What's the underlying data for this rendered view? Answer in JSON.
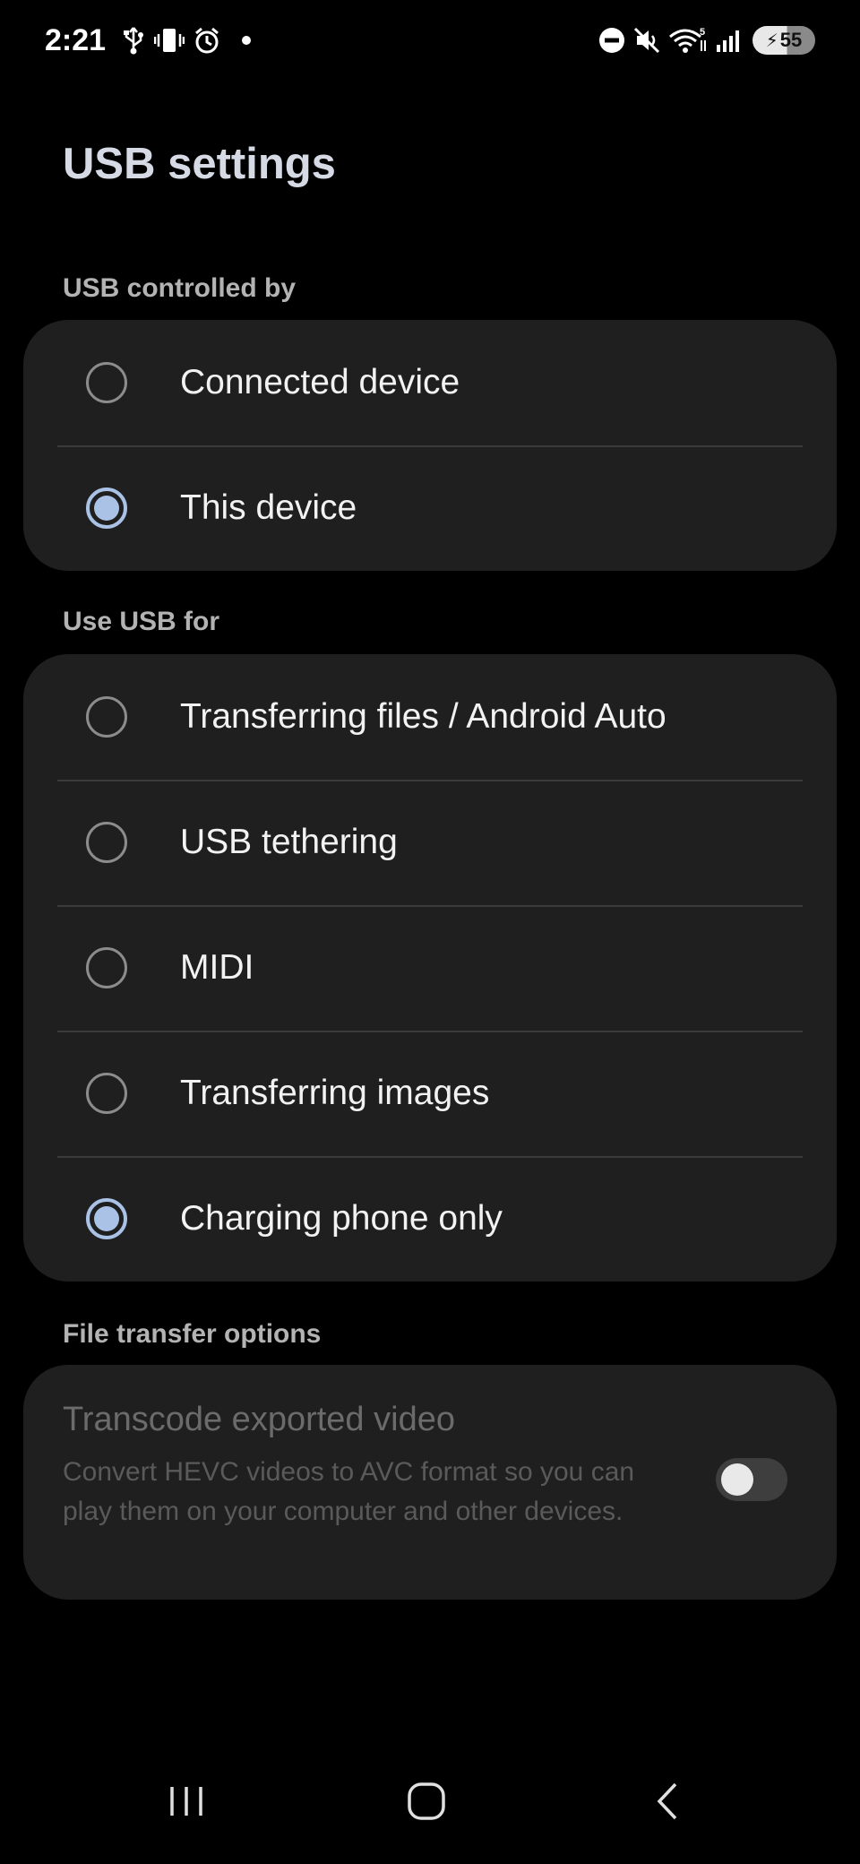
{
  "status_bar": {
    "time": "2:21",
    "battery_level": "55",
    "wifi_badge": "5",
    "left_icons": [
      "usb-icon",
      "vibrate-icon",
      "alarm-icon",
      "notification-dot-icon"
    ],
    "right_icons": [
      "do-not-disturb-icon",
      "mute-icon",
      "wifi-icon",
      "signal-icon",
      "battery-charging-icon"
    ]
  },
  "page": {
    "title": "USB settings"
  },
  "sections": {
    "controlled_by": {
      "header": "USB controlled by",
      "options": [
        {
          "label": "Connected device",
          "selected": false
        },
        {
          "label": "This device",
          "selected": true
        }
      ]
    },
    "use_usb_for": {
      "header": "Use USB for",
      "options": [
        {
          "label": "Transferring files / Android Auto",
          "selected": false
        },
        {
          "label": "USB tethering",
          "selected": false
        },
        {
          "label": "MIDI",
          "selected": false
        },
        {
          "label": "Transferring images",
          "selected": false
        },
        {
          "label": "Charging phone only",
          "selected": true
        }
      ]
    },
    "file_transfer": {
      "header": "File transfer options",
      "transcode": {
        "title": "Transcode exported video",
        "description": "Convert HEVC videos to AVC format so you can play them on your computer and other devices.",
        "enabled": false,
        "toggle_on": false
      }
    }
  },
  "nav_bar": {
    "buttons": [
      "recent-apps-icon",
      "home-icon",
      "back-icon"
    ]
  },
  "colors": {
    "background": "#000000",
    "card": "#1f1f1f",
    "accent": "#a9c2e6",
    "title": "#d5dae4",
    "section_header": "#b3b3b3"
  }
}
